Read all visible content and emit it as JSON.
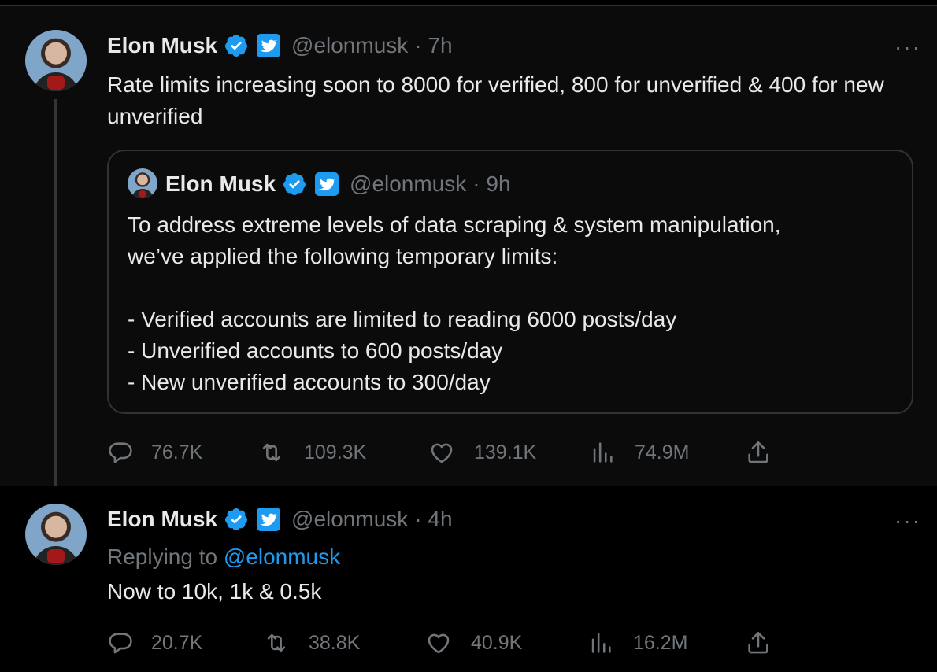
{
  "colors": {
    "background": "#000000",
    "text": "#e7e9ea",
    "muted": "#71767b",
    "accent": "#1d9bf0",
    "border": "#2f3336"
  },
  "tweet1": {
    "name": "Elon Musk",
    "handle": "@elonmusk",
    "time": "· 7h",
    "more": "···",
    "text": "Rate limits increasing soon to 8000 for verified, 800 for unverified & 400 for new unverified",
    "quote": {
      "name": "Elon Musk",
      "handle": "@elonmusk",
      "time": "· 9h",
      "lines": [
        "To address extreme levels of data scraping & system manipulation,",
        "we’ve applied the following temporary limits:",
        "",
        "- Verified accounts are limited to reading 6000 posts/day",
        "- Unverified accounts to 600 posts/day",
        "- New unverified accounts to 300/day"
      ]
    },
    "stats": {
      "replies": "76.7K",
      "reposts": "109.3K",
      "likes": "139.1K",
      "views": "74.9M"
    }
  },
  "tweet2": {
    "name": "Elon Musk",
    "handle": "@elonmusk",
    "time": "· 4h",
    "more": "···",
    "replying_label": "Replying to",
    "replying_mention": "@elonmusk",
    "text": "Now to 10k, 1k & 0.5k",
    "stats": {
      "replies": "20.7K",
      "reposts": "38.8K",
      "likes": "40.9K",
      "views": "16.2M"
    }
  },
  "icons": [
    "verified-badge-icon",
    "twitter-bird-icon",
    "reply-icon",
    "repost-icon",
    "like-icon",
    "views-icon",
    "share-icon",
    "more-icon"
  ]
}
